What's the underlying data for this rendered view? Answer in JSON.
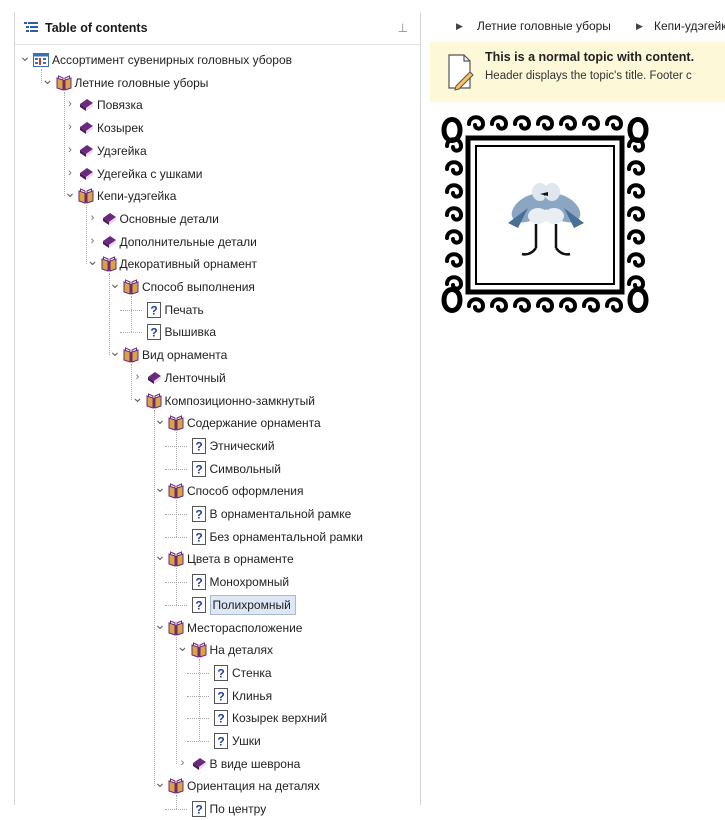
{
  "toc": {
    "title": "Table of contents",
    "pin": "⊥",
    "items": [
      {
        "label": "Ассортимент сувенирных головных уборов",
        "level": 0,
        "icon": "toc-root-icon",
        "chevron": "expanded"
      },
      {
        "label": "Летние головные уборы",
        "level": 1,
        "icon": "open-book-icon",
        "chevron": "expanded"
      },
      {
        "label": "Повязка",
        "level": 2,
        "icon": "closed-book-icon",
        "chevron": "collapsed"
      },
      {
        "label": "Козырек",
        "level": 2,
        "icon": "closed-book-icon",
        "chevron": "collapsed"
      },
      {
        "label": "Удэгейка",
        "level": 2,
        "icon": "closed-book-icon",
        "chevron": "collapsed"
      },
      {
        "label": "Удегейка с ушками",
        "level": 2,
        "icon": "closed-book-icon",
        "chevron": "collapsed"
      },
      {
        "label": "Кепи-удэгейка",
        "level": 2,
        "icon": "open-book-icon",
        "chevron": "expanded"
      },
      {
        "label": "Основные детали",
        "level": 3,
        "icon": "closed-book-icon",
        "chevron": "collapsed"
      },
      {
        "label": "Дополнительные детали",
        "level": 3,
        "icon": "closed-book-icon",
        "chevron": "collapsed"
      },
      {
        "label": "Декоративный орнамент",
        "level": 3,
        "icon": "open-book-icon",
        "chevron": "expanded"
      },
      {
        "label": "Способ выполнения",
        "level": 4,
        "icon": "open-book-icon",
        "chevron": "expanded"
      },
      {
        "label": "Печать",
        "level": 5,
        "icon": "topic-icon",
        "chevron": "none"
      },
      {
        "label": "Вышивка",
        "level": 5,
        "icon": "topic-icon",
        "chevron": "none"
      },
      {
        "label": "Вид орнамента",
        "level": 4,
        "icon": "open-book-icon",
        "chevron": "expanded"
      },
      {
        "label": "Ленточный",
        "level": 5,
        "icon": "closed-book-icon",
        "chevron": "collapsed"
      },
      {
        "label": "Композиционно-замкнутый",
        "level": 5,
        "icon": "open-book-icon",
        "chevron": "expanded"
      },
      {
        "label": "Содержание орнамента",
        "level": 6,
        "icon": "open-book-icon",
        "chevron": "expanded"
      },
      {
        "label": "Этнический",
        "level": 7,
        "icon": "topic-icon",
        "chevron": "none"
      },
      {
        "label": "Символьный",
        "level": 7,
        "icon": "topic-icon",
        "chevron": "none"
      },
      {
        "label": "Способ оформления",
        "level": 6,
        "icon": "open-book-icon",
        "chevron": "expanded"
      },
      {
        "label": "В орнаментальной рамке",
        "level": 7,
        "icon": "topic-icon",
        "chevron": "none"
      },
      {
        "label": "Без орнаментальной рамки",
        "level": 7,
        "icon": "topic-icon",
        "chevron": "none"
      },
      {
        "label": "Цвета в орнаменте",
        "level": 6,
        "icon": "open-book-icon",
        "chevron": "expanded"
      },
      {
        "label": "Монохромный",
        "level": 7,
        "icon": "topic-icon",
        "chevron": "none"
      },
      {
        "label": "Полихромный",
        "level": 7,
        "icon": "topic-icon",
        "chevron": "none",
        "selected": true
      },
      {
        "label": "Месторасположение",
        "level": 6,
        "icon": "open-book-icon",
        "chevron": "expanded"
      },
      {
        "label": "На деталях",
        "level": 7,
        "icon": "open-book-icon",
        "chevron": "expanded"
      },
      {
        "label": "Стенка",
        "level": 8,
        "icon": "topic-icon",
        "chevron": "none"
      },
      {
        "label": "Клинья",
        "level": 8,
        "icon": "topic-icon",
        "chevron": "none"
      },
      {
        "label": "Козырек верхний",
        "level": 8,
        "icon": "topic-icon",
        "chevron": "none"
      },
      {
        "label": "Ушки",
        "level": 8,
        "icon": "topic-icon",
        "chevron": "none"
      },
      {
        "label": "В виде шеврона",
        "level": 7,
        "icon": "closed-book-icon",
        "chevron": "collapsed"
      },
      {
        "label": "Ориентация на деталях",
        "level": 6,
        "icon": "open-book-icon",
        "chevron": "expanded"
      },
      {
        "label": "По центру",
        "level": 7,
        "icon": "topic-icon",
        "chevron": "none"
      }
    ]
  },
  "breadcrumb": [
    "Летние головные уборы",
    "Кепи-удэгейка"
  ],
  "note": {
    "title": "This is a normal topic with content.",
    "text": "Header displays the topic's title.  Footer c"
  },
  "colors": {
    "book_purple": "#6b2a7e",
    "book_gold": "#d9a441",
    "topic_blue": "#1f3f9a",
    "selection": "#dde7f5",
    "note_bg": "#fdf8d8"
  }
}
